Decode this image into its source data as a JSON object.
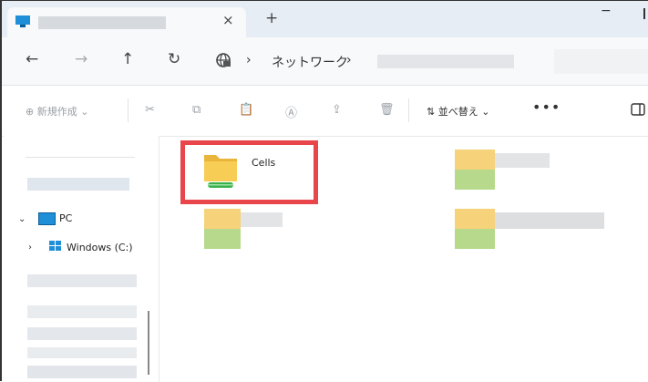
{
  "tab": {
    "close_glyph": "×",
    "new_glyph": "+"
  },
  "window": {
    "minimize_glyph": "−"
  },
  "nav": {
    "back_glyph": "←",
    "forward_glyph": "→",
    "up_glyph": "↑",
    "refresh_glyph": "↻",
    "breadcrumb_sep": "›",
    "breadcrumb_network": "ネットワーク",
    "breadcrumb_sep2": "›"
  },
  "cmd": {
    "new_label": "⊕ 新規作成 ⌄",
    "cut_icon": "✂",
    "copy_icon": "⧉",
    "paste_icon": "📋",
    "rename_icon": "Ⓐ",
    "share_icon": "⇪",
    "delete_icon": "🗑",
    "sort_label": "⇅ 並べ替え ⌄",
    "more_label": "•••"
  },
  "sidebar": {
    "pc_chevron": "⌄",
    "pc_label": "PC",
    "drive_chevron": "›",
    "drive_label": "Windows (C:)"
  },
  "content": {
    "folder_label": "Cells"
  },
  "colors": {
    "highlight": "#e8464a",
    "folder": "#f5c84c",
    "share_bar": "#3cb04a"
  }
}
